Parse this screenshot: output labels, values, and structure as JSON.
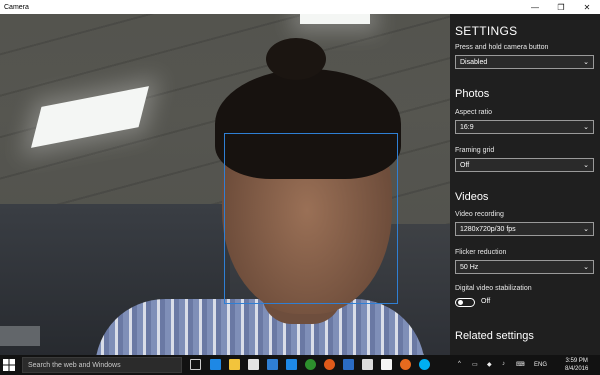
{
  "window": {
    "title": "Camera",
    "minimize": "—",
    "maximize": "❐",
    "close": "✕"
  },
  "settings": {
    "heading": "SETTINGS",
    "press_hold_label": "Press and hold camera button",
    "press_hold_value": "Disabled",
    "photos_heading": "Photos",
    "aspect_label": "Aspect ratio",
    "aspect_value": "16:9",
    "grid_label": "Framing grid",
    "grid_value": "Off",
    "videos_heading": "Videos",
    "video_rec_label": "Video recording",
    "video_rec_value": "1280x720p/30 fps",
    "flicker_label": "Flicker reduction",
    "flicker_value": "50 Hz",
    "stabilization_label": "Digital video stabilization",
    "stabilization_value": "Off",
    "related_heading": "Related settings"
  },
  "taskbar": {
    "search_placeholder": "Search the web and Windows",
    "language": "ENG",
    "time": "3:59 PM",
    "date": "8/4/2016",
    "icons": [
      "task-view",
      "edge",
      "file-explorer",
      "store",
      "mail",
      "photos",
      "xbox",
      "groove-music",
      "movies",
      "camera",
      "paint",
      "firefox",
      "skype"
    ]
  },
  "colors": {
    "face_box": "#2f7fd4",
    "panel_bg": "#1f1f1f",
    "taskbar_bg": "#121212"
  }
}
